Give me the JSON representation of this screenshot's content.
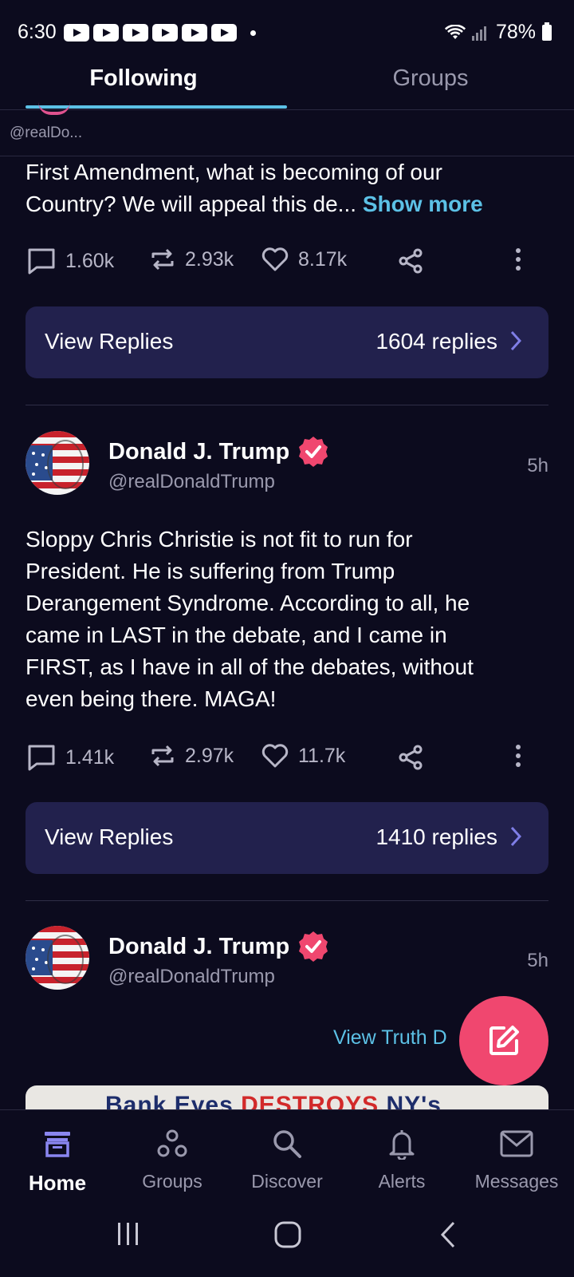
{
  "status_bar": {
    "time": "6:30",
    "battery": "78%"
  },
  "tabs": {
    "following": "Following",
    "groups": "Groups"
  },
  "mini_author": {
    "handle": "@realDo..."
  },
  "post1": {
    "text_lines": [
      "First Amendment, what is becoming of our",
      "Country? We will appeal this de..."
    ],
    "show_more": "Show more",
    "replies_count": "1.60k",
    "retruths_count": "2.93k",
    "likes_count": "8.17k",
    "view_replies_label": "View Replies",
    "replies_total": "1604 replies"
  },
  "post2": {
    "author_name": "Donald J. Trump",
    "author_handle": "@realDonaldTrump",
    "time": "5h",
    "text_lines": [
      "Sloppy Chris Christie is not fit to run for",
      "President. He is suffering from Trump",
      "Derangement Syndrome. According to all, he",
      "came in LAST in the debate, and I came in",
      "FIRST, as I have in all of the debates, without",
      "even being there. MAGA!"
    ],
    "replies_count": "1.41k",
    "retruths_count": "2.97k",
    "likes_count": "11.7k",
    "view_replies_label": "View Replies",
    "replies_total": "1410 replies"
  },
  "post3": {
    "author_name": "Donald J. Trump",
    "author_handle": "@realDonaldTrump",
    "time": "5h",
    "view_truth": "View Truth D",
    "image_caption_start": "Bank Eyes ",
    "image_caption_red": "DESTROYS",
    "image_caption_end": " NY's"
  },
  "bottom_nav": {
    "home": "Home",
    "groups": "Groups",
    "discover": "Discover",
    "alerts": "Alerts",
    "messages": "Messages"
  },
  "colors": {
    "background": "#0c0b1e",
    "accent": "#5cc1e6",
    "card": "#22214d",
    "fab": "#f0476f",
    "verified": "#f0476f"
  }
}
